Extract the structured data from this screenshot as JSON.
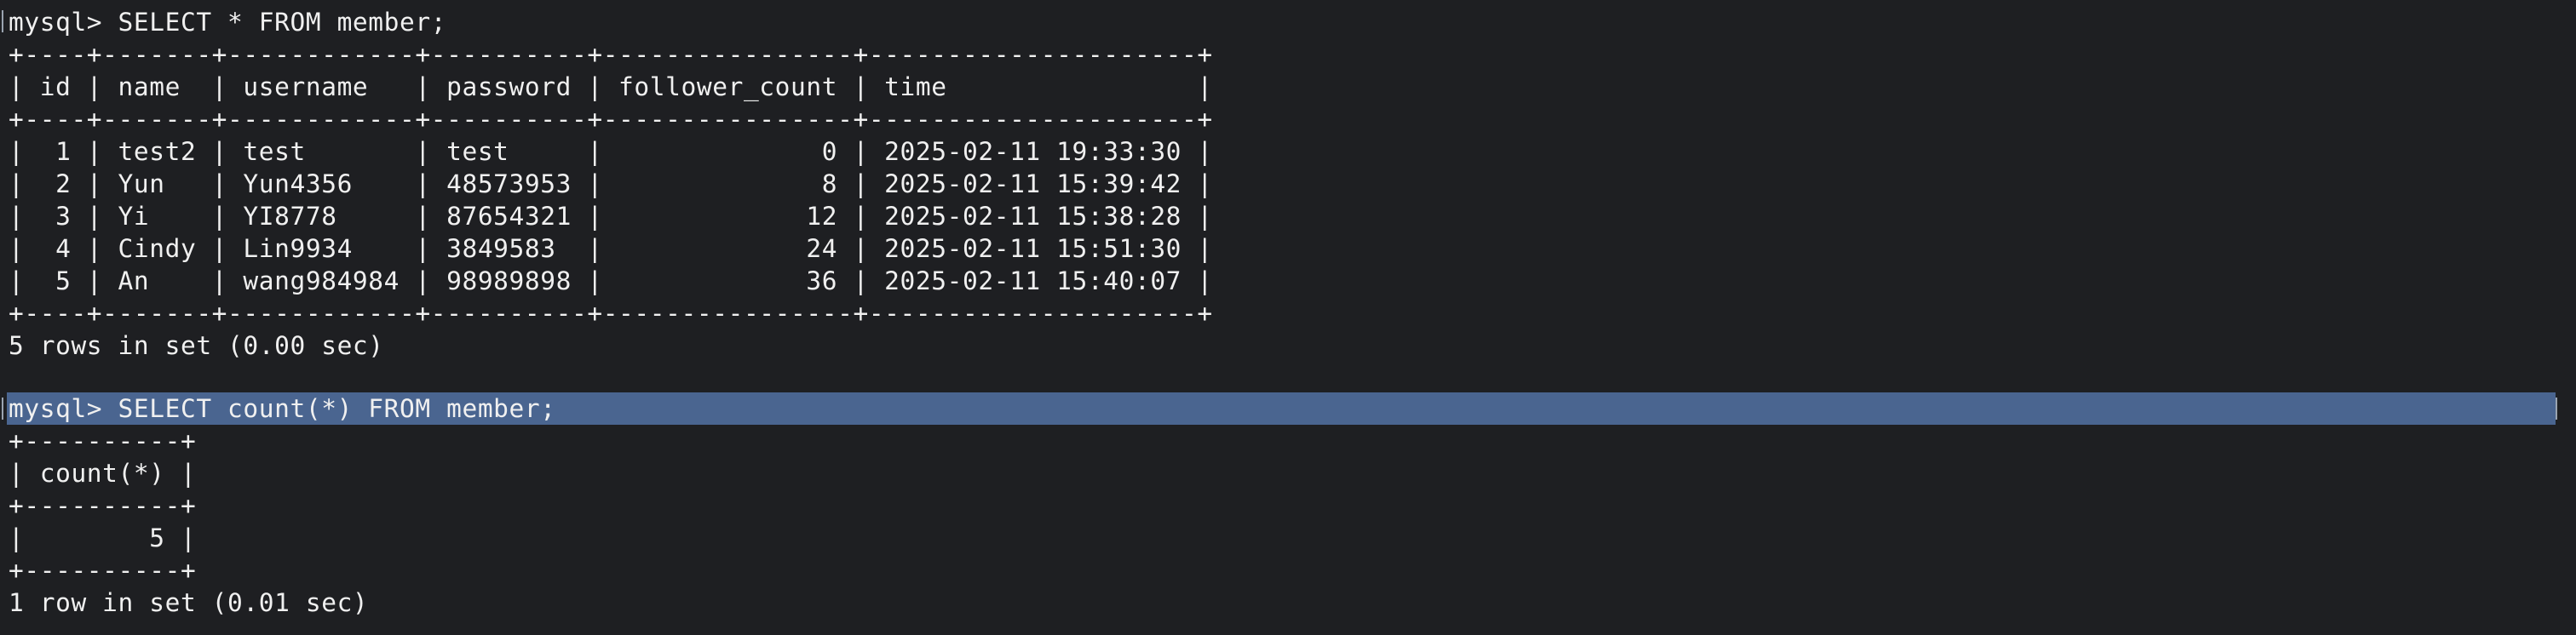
{
  "terminal": {
    "lines": [
      "mysql> SELECT * FROM member;",
      "+----+-------+------------+----------+----------------+---------------------+",
      "| id | name  | username   | password | follower_count | time                |",
      "+----+-------+------------+----------+----------------+---------------------+",
      "|  1 | test2 | test       | test     |              0 | 2025-02-11 19:33:30 |",
      "|  2 | Yun   | Yun4356    | 48573953 |              8 | 2025-02-11 15:39:42 |",
      "|  3 | Yi    | YI8778     | 87654321 |             12 | 2025-02-11 15:38:28 |",
      "|  4 | Cindy | Lin9934    | 3849583  |             24 | 2025-02-11 15:51:30 |",
      "|  5 | An    | wang984984 | 98989898 |             36 | 2025-02-11 15:40:07 |",
      "+----+-------+------------+----------+----------------+---------------------+",
      "5 rows in set (0.00 sec)",
      "",
      "mysql> SELECT count(*) FROM member;",
      "+----------+",
      "| count(*) |",
      "+----------+",
      "|        5 |",
      "+----------+",
      "1 row in set (0.01 sec)"
    ]
  },
  "colors": {
    "background": "#1e1f22",
    "text": "#f0f0f0",
    "selection": "#4a6590"
  }
}
